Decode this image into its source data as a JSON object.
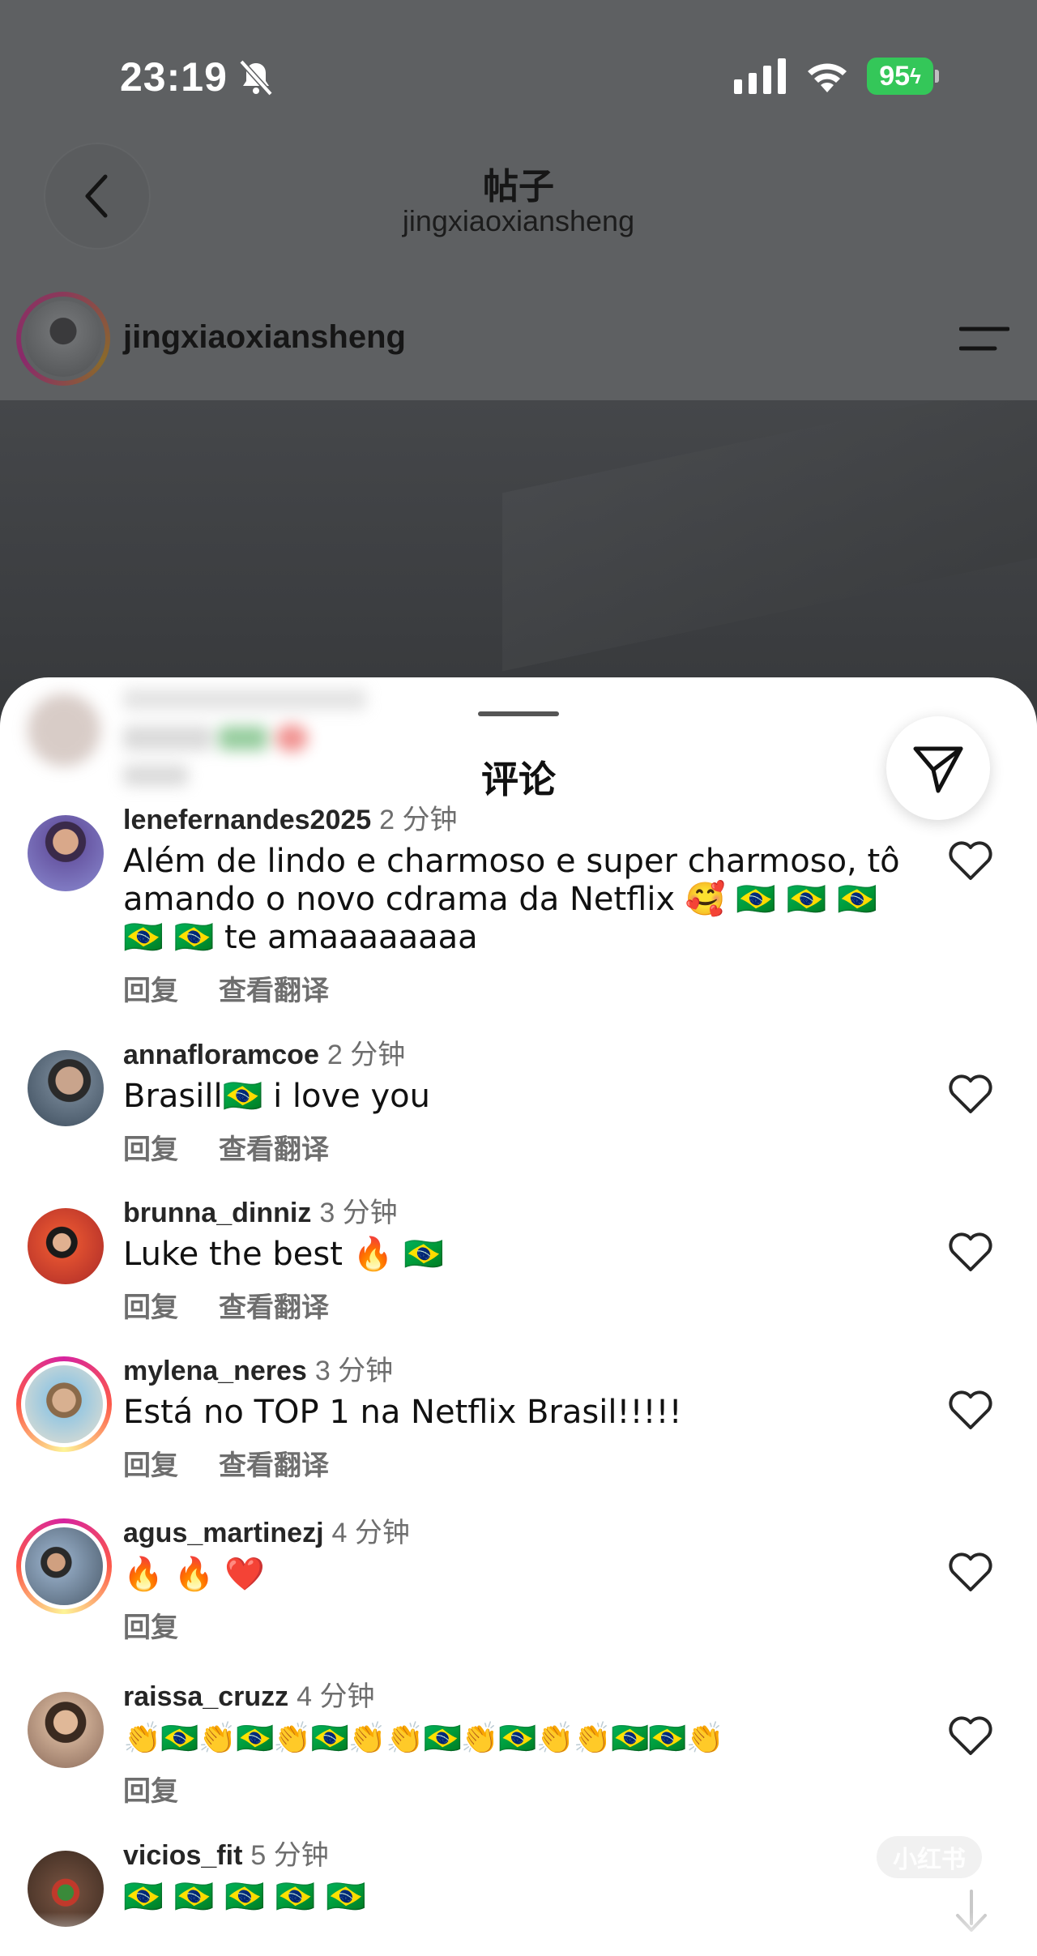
{
  "status_bar": {
    "time": "23:19",
    "battery": "95"
  },
  "nav": {
    "title": "帖子",
    "subtitle": "jingxiaoxiansheng"
  },
  "post": {
    "username": "jingxiaoxiansheng"
  },
  "sheet": {
    "title": "评论"
  },
  "comments": [
    {
      "username": "lenefernandes2025",
      "time": "2 分钟",
      "text": "Além de lindo e charmoso e super charmoso, tô amando o novo cdrama da Netflix 🥰 🇧🇷 🇧🇷 🇧🇷 🇧🇷 🇧🇷 te amaaaaaaaa",
      "reply": "回复",
      "translate": "查看翻译",
      "avatar_color": "#7a5a9a"
    },
    {
      "username": "annafloramcoe",
      "time": "2 分钟",
      "text": "Brasill🇧🇷 i love you",
      "reply": "回复",
      "translate": "查看翻译",
      "avatar_color": "#5a6a7a"
    },
    {
      "username": "brunna_dinniz",
      "time": "3 分钟",
      "text": "Luke the best 🔥 🇧🇷",
      "reply": "回复",
      "translate": "查看翻译",
      "avatar_color": "#c0392b"
    },
    {
      "username": "mylena_neres",
      "time": "3 分钟",
      "text": "Está no TOP 1 na Netflix Brasil!!!!!",
      "reply": "回复",
      "translate": "查看翻译",
      "avatar_color": "#7fb3c8"
    },
    {
      "username": "agus_martinezj",
      "time": "4 分钟",
      "text": "🔥 🔥 ❤️",
      "reply": "回复",
      "translate": "",
      "avatar_color": "#6a7a8a"
    },
    {
      "username": "raissa_cruzz",
      "time": "4 分钟",
      "text": "👏🇧🇷👏🇧🇷👏🇧🇷👏👏🇧🇷👏🇧🇷👏👏🇧🇷🇧🇷👏",
      "reply": "回复",
      "translate": "",
      "avatar_color": "#9a7a6a"
    },
    {
      "username": "vicios_fit",
      "time": "5 分钟",
      "text": "🇧🇷 🇧🇷 🇧🇷 🇧🇷 🇧🇷",
      "reply": "",
      "translate": "",
      "avatar_color": "#5a4a3a"
    }
  ],
  "watermark": "小红书",
  "colors": {
    "accent_battery": "#34c759",
    "text_secondary": "#6e6e6e",
    "overlay": "#5e6062"
  }
}
